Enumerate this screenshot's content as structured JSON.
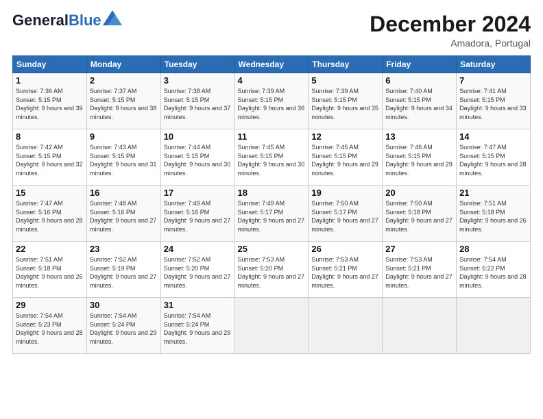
{
  "header": {
    "logo_line1": "General",
    "logo_line2": "Blue",
    "month_title": "December 2024",
    "location": "Amadora, Portugal"
  },
  "weekdays": [
    "Sunday",
    "Monday",
    "Tuesday",
    "Wednesday",
    "Thursday",
    "Friday",
    "Saturday"
  ],
  "weeks": [
    [
      {
        "day": "1",
        "sunrise": "7:36 AM",
        "sunset": "5:15 PM",
        "daylight": "9 hours and 39 minutes."
      },
      {
        "day": "2",
        "sunrise": "7:37 AM",
        "sunset": "5:15 PM",
        "daylight": "9 hours and 38 minutes."
      },
      {
        "day": "3",
        "sunrise": "7:38 AM",
        "sunset": "5:15 PM",
        "daylight": "9 hours and 37 minutes."
      },
      {
        "day": "4",
        "sunrise": "7:39 AM",
        "sunset": "5:15 PM",
        "daylight": "9 hours and 36 minutes."
      },
      {
        "day": "5",
        "sunrise": "7:39 AM",
        "sunset": "5:15 PM",
        "daylight": "9 hours and 35 minutes."
      },
      {
        "day": "6",
        "sunrise": "7:40 AM",
        "sunset": "5:15 PM",
        "daylight": "9 hours and 34 minutes."
      },
      {
        "day": "7",
        "sunrise": "7:41 AM",
        "sunset": "5:15 PM",
        "daylight": "9 hours and 33 minutes."
      }
    ],
    [
      {
        "day": "8",
        "sunrise": "7:42 AM",
        "sunset": "5:15 PM",
        "daylight": "9 hours and 32 minutes."
      },
      {
        "day": "9",
        "sunrise": "7:43 AM",
        "sunset": "5:15 PM",
        "daylight": "9 hours and 31 minutes."
      },
      {
        "day": "10",
        "sunrise": "7:44 AM",
        "sunset": "5:15 PM",
        "daylight": "9 hours and 30 minutes."
      },
      {
        "day": "11",
        "sunrise": "7:45 AM",
        "sunset": "5:15 PM",
        "daylight": "9 hours and 30 minutes."
      },
      {
        "day": "12",
        "sunrise": "7:45 AM",
        "sunset": "5:15 PM",
        "daylight": "9 hours and 29 minutes."
      },
      {
        "day": "13",
        "sunrise": "7:46 AM",
        "sunset": "5:15 PM",
        "daylight": "9 hours and 29 minutes."
      },
      {
        "day": "14",
        "sunrise": "7:47 AM",
        "sunset": "5:15 PM",
        "daylight": "9 hours and 28 minutes."
      }
    ],
    [
      {
        "day": "15",
        "sunrise": "7:47 AM",
        "sunset": "5:16 PM",
        "daylight": "9 hours and 28 minutes."
      },
      {
        "day": "16",
        "sunrise": "7:48 AM",
        "sunset": "5:16 PM",
        "daylight": "9 hours and 27 minutes."
      },
      {
        "day": "17",
        "sunrise": "7:49 AM",
        "sunset": "5:16 PM",
        "daylight": "9 hours and 27 minutes."
      },
      {
        "day": "18",
        "sunrise": "7:49 AM",
        "sunset": "5:17 PM",
        "daylight": "9 hours and 27 minutes."
      },
      {
        "day": "19",
        "sunrise": "7:50 AM",
        "sunset": "5:17 PM",
        "daylight": "9 hours and 27 minutes."
      },
      {
        "day": "20",
        "sunrise": "7:50 AM",
        "sunset": "5:18 PM",
        "daylight": "9 hours and 27 minutes."
      },
      {
        "day": "21",
        "sunrise": "7:51 AM",
        "sunset": "5:18 PM",
        "daylight": "9 hours and 26 minutes."
      }
    ],
    [
      {
        "day": "22",
        "sunrise": "7:51 AM",
        "sunset": "5:18 PM",
        "daylight": "9 hours and 26 minutes."
      },
      {
        "day": "23",
        "sunrise": "7:52 AM",
        "sunset": "5:19 PM",
        "daylight": "9 hours and 27 minutes."
      },
      {
        "day": "24",
        "sunrise": "7:52 AM",
        "sunset": "5:20 PM",
        "daylight": "9 hours and 27 minutes."
      },
      {
        "day": "25",
        "sunrise": "7:53 AM",
        "sunset": "5:20 PM",
        "daylight": "9 hours and 27 minutes."
      },
      {
        "day": "26",
        "sunrise": "7:53 AM",
        "sunset": "5:21 PM",
        "daylight": "9 hours and 27 minutes."
      },
      {
        "day": "27",
        "sunrise": "7:53 AM",
        "sunset": "5:21 PM",
        "daylight": "9 hours and 27 minutes."
      },
      {
        "day": "28",
        "sunrise": "7:54 AM",
        "sunset": "5:22 PM",
        "daylight": "9 hours and 28 minutes."
      }
    ],
    [
      {
        "day": "29",
        "sunrise": "7:54 AM",
        "sunset": "5:23 PM",
        "daylight": "9 hours and 28 minutes."
      },
      {
        "day": "30",
        "sunrise": "7:54 AM",
        "sunset": "5:24 PM",
        "daylight": "9 hours and 29 minutes."
      },
      {
        "day": "31",
        "sunrise": "7:54 AM",
        "sunset": "5:24 PM",
        "daylight": "9 hours and 29 minutes."
      },
      null,
      null,
      null,
      null
    ]
  ]
}
